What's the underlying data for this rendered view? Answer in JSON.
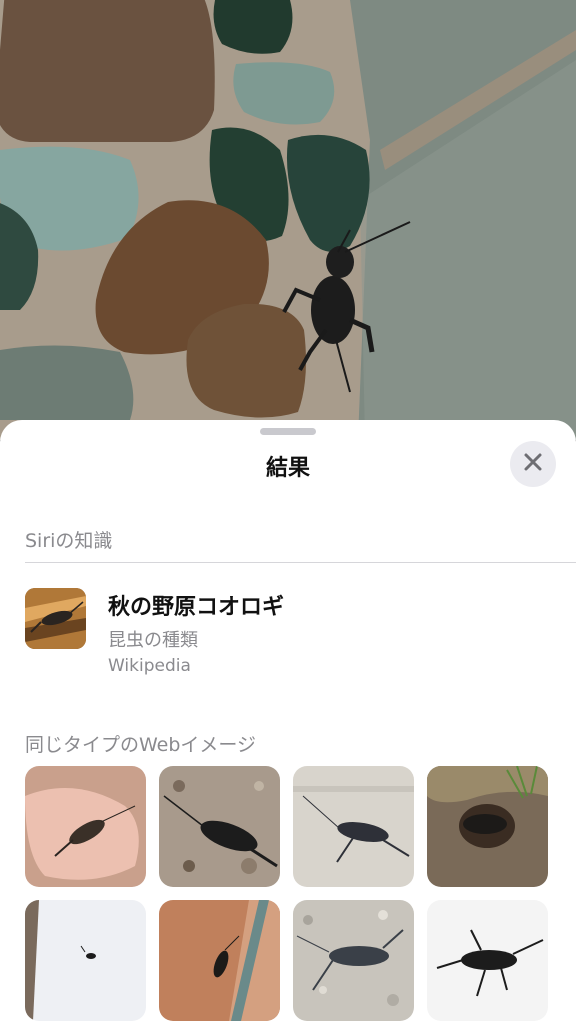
{
  "sheet": {
    "title": "結果",
    "close_icon": "xmark-icon"
  },
  "siri_knowledge": {
    "section_label": "Siriの知識",
    "result": {
      "title": "秋の野原コオロギ",
      "subtitle": "昆虫の種類",
      "source": "Wikipedia"
    }
  },
  "web_images": {
    "section_label": "同じタイプのWebイメージ",
    "tiles": [
      {
        "description": "cricket on hand",
        "bg": "#e8b8a8"
      },
      {
        "description": "cricket on gravel",
        "bg": "#a89a8c"
      },
      {
        "description": "cricket on concrete",
        "bg": "#d8d4cc"
      },
      {
        "description": "cricket in dirt",
        "bg": "#7a6a58"
      },
      {
        "description": "small cricket on white",
        "bg": "#eef0f4"
      },
      {
        "description": "cricket on brick",
        "bg": "#c0805c"
      },
      {
        "description": "cricket on pebbles",
        "bg": "#c8c4bc"
      },
      {
        "description": "cricket on white",
        "bg": "#f4f4f4"
      }
    ]
  }
}
